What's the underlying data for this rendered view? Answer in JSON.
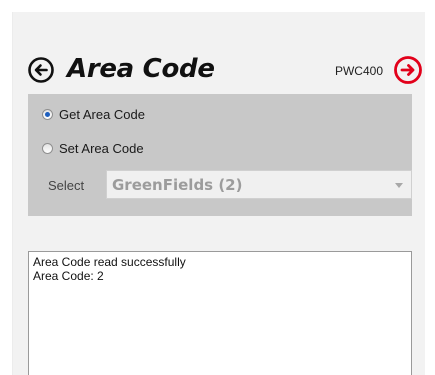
{
  "header": {
    "title": "Area Code",
    "device_id": "PWC400",
    "back_icon": "circle-arrow-left-icon",
    "forward_icon": "circle-arrow-right-icon",
    "forward_color": "#e2001a"
  },
  "options": {
    "radios": [
      {
        "label": "Get Area Code",
        "selected": true
      },
      {
        "label": "Set Area Code",
        "selected": false
      }
    ],
    "select_label": "Select",
    "select_value": "GreenFields (2)",
    "select_enabled": false
  },
  "log": {
    "lines": [
      "Area Code read successfully",
      "Area Code: 2"
    ]
  }
}
